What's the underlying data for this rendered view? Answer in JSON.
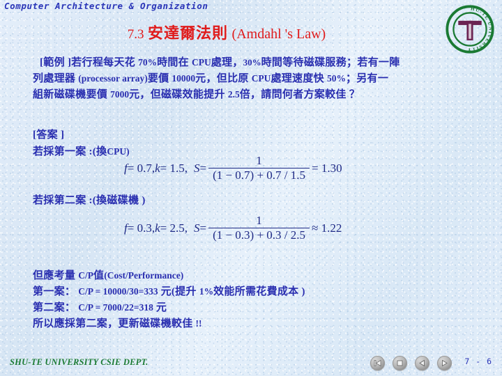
{
  "header": {
    "course_title": "Computer Architecture & Organization"
  },
  "logo": {
    "ring_text": "SHU-TE UNIVERSITY",
    "mark": "T",
    "ring_color": "#1a7a33",
    "mark_color": "#6b2352"
  },
  "title": {
    "number": "7.3",
    "cjk": "安達爾法則",
    "english": "(Amdahl 's Law)",
    "color": "#e01b1b"
  },
  "problem": {
    "label": "[範例 ]",
    "line1_a": "若行程每天花",
    "line1_pct1": "70%",
    "line1_b": "時間在",
    "line1_cpu": "CPU",
    "line1_c": "處理，",
    "line1_pct2": "30%",
    "line1_d": "時間等待磁碟服務；若有一陣",
    "line2_a": "列處理器",
    "line2_paren": "(processor array)",
    "line2_b": "要價",
    "line2_price": "10000",
    "line2_c": "元，但比原",
    "line2_cpu": "CPU",
    "line2_d": "處理速度快",
    "line2_pct": "50%",
    "line2_e": "；另有一",
    "line3_a": "組新磁碟機要價",
    "line3_price": "7000",
    "line3_b": "元，但磁碟效能提升",
    "line3_x": "2.5",
    "line3_c": "倍，請問何者方案較佳",
    "line3_q": "？"
  },
  "answer": {
    "label": "[答案 ]",
    "case1_label": "若採第一案",
    "case1_paren_a": ":(換",
    "case1_paren_b": "CPU",
    "case1_paren_c": ")",
    "case2_label": "若採第二案",
    "case2_paren": ":(換磁碟機 )"
  },
  "formula1": {
    "f_var": "f",
    "f_eq": " = 0.7,",
    "k_var": "k",
    "k_eq": " = 1.5,",
    "s_var": "S",
    "s_eq": " =",
    "numerator": "1",
    "denominator": "(1 − 0.7) + 0.7 / 1.5",
    "result": "= 1.30"
  },
  "formula2": {
    "f_var": "f",
    "f_eq": " = 0.3,",
    "k_var": "k",
    "k_eq": " = 2.5,",
    "s_var": "S",
    "s_eq": " =",
    "numerator": "1",
    "denominator": "(1 − 0.3) + 0.3 / 2.5",
    "result": "≈ 1.22"
  },
  "conclusion": {
    "line1_a": "但應考量",
    "line1_cp": "C/P",
    "line1_b": "值",
    "line1_paren": "(Cost/Performance)",
    "line2_label": "第一案：",
    "line2_value": "C/P = 10000/30=333",
    "line2_unit": "元",
    "line2_note_a": "(提升",
    "line2_note_pct": "1%",
    "line2_note_b": "效能所需花費成本",
    "line2_note_c": ")",
    "line3_label": "第二案：",
    "line3_value": "C/P = 7000/22=318",
    "line3_unit": "元",
    "line4_a": "所以應採第二案，更新磁碟機較佳",
    "line4_b": "!!"
  },
  "footer": {
    "org": "SHU-TE UNIVERSITY  CSIE DEPT.",
    "page": "7 - 6",
    "nav": [
      {
        "name": "first-slide",
        "icon": "first-icon"
      },
      {
        "name": "stop",
        "icon": "stop-icon"
      },
      {
        "name": "previous-slide",
        "icon": "previous-icon"
      },
      {
        "name": "next-slide",
        "icon": "next-icon"
      }
    ]
  }
}
